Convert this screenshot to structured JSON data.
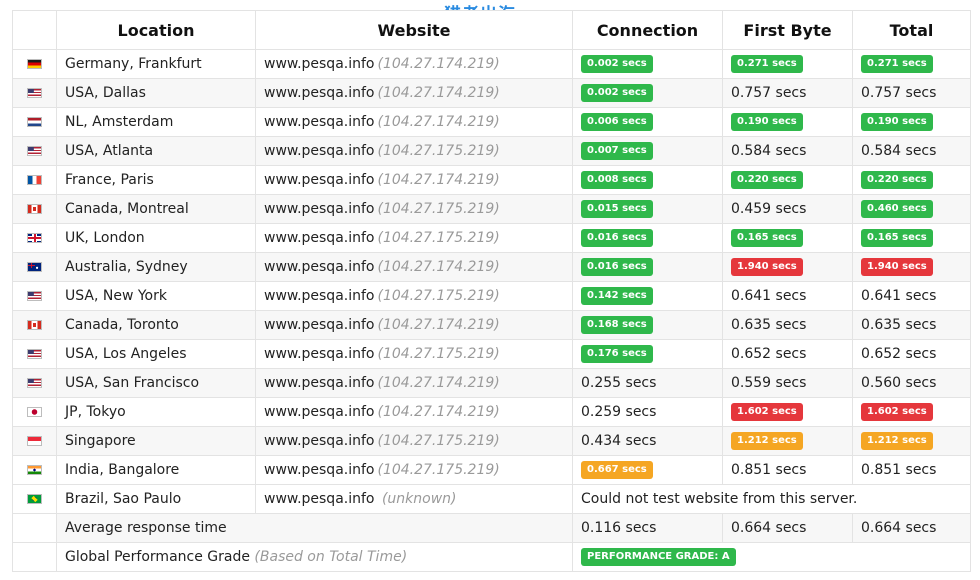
{
  "headers": {
    "location": "Location",
    "website": "Website",
    "connection": "Connection",
    "first_byte": "First Byte",
    "total": "Total"
  },
  "watermark": "猎者出海",
  "unit": "secs",
  "colors": {
    "green": "#2fb84b",
    "red": "#e5373c",
    "orange": "#f5a623"
  },
  "rows": [
    {
      "flag": "de",
      "flag_icon": "germany-flag-icon",
      "location": "Germany, Frankfurt",
      "host": "www.pesqa.info",
      "ip": "(104.27.174.219)",
      "connection": {
        "text": "0.002 secs",
        "badge": "green"
      },
      "first_byte": {
        "text": "0.271 secs",
        "badge": "green"
      },
      "total": {
        "text": "0.271 secs",
        "badge": "green"
      }
    },
    {
      "flag": "us",
      "flag_icon": "usa-flag-icon",
      "location": "USA, Dallas",
      "host": "www.pesqa.info",
      "ip": "(104.27.174.219)",
      "connection": {
        "text": "0.002 secs",
        "badge": "green"
      },
      "first_byte": {
        "text": "0.757 secs",
        "badge": ""
      },
      "total": {
        "text": "0.757 secs",
        "badge": ""
      }
    },
    {
      "flag": "nl",
      "flag_icon": "netherlands-flag-icon",
      "location": "NL, Amsterdam",
      "host": "www.pesqa.info",
      "ip": "(104.27.174.219)",
      "connection": {
        "text": "0.006 secs",
        "badge": "green"
      },
      "first_byte": {
        "text": "0.190 secs",
        "badge": "green"
      },
      "total": {
        "text": "0.190 secs",
        "badge": "green"
      }
    },
    {
      "flag": "us",
      "flag_icon": "usa-flag-icon",
      "location": "USA, Atlanta",
      "host": "www.pesqa.info",
      "ip": "(104.27.175.219)",
      "connection": {
        "text": "0.007 secs",
        "badge": "green"
      },
      "first_byte": {
        "text": "0.584 secs",
        "badge": ""
      },
      "total": {
        "text": "0.584 secs",
        "badge": ""
      }
    },
    {
      "flag": "fr",
      "flag_icon": "france-flag-icon",
      "location": "France, Paris",
      "host": "www.pesqa.info",
      "ip": "(104.27.174.219)",
      "connection": {
        "text": "0.008 secs",
        "badge": "green"
      },
      "first_byte": {
        "text": "0.220 secs",
        "badge": "green"
      },
      "total": {
        "text": "0.220 secs",
        "badge": "green"
      }
    },
    {
      "flag": "ca",
      "flag_icon": "canada-flag-icon",
      "location": "Canada, Montreal",
      "host": "www.pesqa.info",
      "ip": "(104.27.175.219)",
      "connection": {
        "text": "0.015 secs",
        "badge": "green"
      },
      "first_byte": {
        "text": "0.459 secs",
        "badge": ""
      },
      "total": {
        "text": "0.460 secs",
        "badge": "green"
      }
    },
    {
      "flag": "uk",
      "flag_icon": "uk-flag-icon",
      "location": "UK, London",
      "host": "www.pesqa.info",
      "ip": "(104.27.175.219)",
      "connection": {
        "text": "0.016 secs",
        "badge": "green"
      },
      "first_byte": {
        "text": "0.165 secs",
        "badge": "green"
      },
      "total": {
        "text": "0.165 secs",
        "badge": "green"
      }
    },
    {
      "flag": "au",
      "flag_icon": "australia-flag-icon",
      "location": "Australia, Sydney",
      "host": "www.pesqa.info",
      "ip": "(104.27.174.219)",
      "connection": {
        "text": "0.016 secs",
        "badge": "green"
      },
      "first_byte": {
        "text": "1.940 secs",
        "badge": "red"
      },
      "total": {
        "text": "1.940 secs",
        "badge": "red"
      }
    },
    {
      "flag": "us",
      "flag_icon": "usa-flag-icon",
      "location": "USA, New York",
      "host": "www.pesqa.info",
      "ip": "(104.27.175.219)",
      "connection": {
        "text": "0.142 secs",
        "badge": "green"
      },
      "first_byte": {
        "text": "0.641 secs",
        "badge": ""
      },
      "total": {
        "text": "0.641 secs",
        "badge": ""
      }
    },
    {
      "flag": "ca",
      "flag_icon": "canada-flag-icon",
      "location": "Canada, Toronto",
      "host": "www.pesqa.info",
      "ip": "(104.27.174.219)",
      "connection": {
        "text": "0.168 secs",
        "badge": "green"
      },
      "first_byte": {
        "text": "0.635 secs",
        "badge": ""
      },
      "total": {
        "text": "0.635 secs",
        "badge": ""
      }
    },
    {
      "flag": "us",
      "flag_icon": "usa-flag-icon",
      "location": "USA, Los Angeles",
      "host": "www.pesqa.info",
      "ip": "(104.27.175.219)",
      "connection": {
        "text": "0.176 secs",
        "badge": "green"
      },
      "first_byte": {
        "text": "0.652 secs",
        "badge": ""
      },
      "total": {
        "text": "0.652 secs",
        "badge": ""
      }
    },
    {
      "flag": "us",
      "flag_icon": "usa-flag-icon",
      "location": "USA, San Francisco",
      "host": "www.pesqa.info",
      "ip": "(104.27.174.219)",
      "connection": {
        "text": "0.255 secs",
        "badge": ""
      },
      "first_byte": {
        "text": "0.559 secs",
        "badge": ""
      },
      "total": {
        "text": "0.560 secs",
        "badge": ""
      }
    },
    {
      "flag": "jp",
      "flag_icon": "japan-flag-icon",
      "location": "JP, Tokyo",
      "host": "www.pesqa.info",
      "ip": "(104.27.174.219)",
      "connection": {
        "text": "0.259 secs",
        "badge": ""
      },
      "first_byte": {
        "text": "1.602 secs",
        "badge": "red"
      },
      "total": {
        "text": "1.602 secs",
        "badge": "red"
      }
    },
    {
      "flag": "sg",
      "flag_icon": "singapore-flag-icon",
      "location": "Singapore",
      "host": "www.pesqa.info",
      "ip": "(104.27.175.219)",
      "connection": {
        "text": "0.434 secs",
        "badge": ""
      },
      "first_byte": {
        "text": "1.212 secs",
        "badge": "orange"
      },
      "total": {
        "text": "1.212 secs",
        "badge": "orange"
      }
    },
    {
      "flag": "in",
      "flag_icon": "india-flag-icon",
      "location": "India, Bangalore",
      "host": "www.pesqa.info",
      "ip": "(104.27.175.219)",
      "connection": {
        "text": "0.667 secs",
        "badge": "orange"
      },
      "first_byte": {
        "text": "0.851 secs",
        "badge": ""
      },
      "total": {
        "text": "0.851 secs",
        "badge": ""
      }
    }
  ],
  "brazil_row": {
    "flag": "br",
    "flag_icon": "brazil-flag-icon",
    "location": "Brazil, Sao Paulo",
    "host": "www.pesqa.info",
    "ip": "(unknown)",
    "message": "Could not test website from this server."
  },
  "average": {
    "label": "Average response time",
    "connection": "0.116 secs",
    "first_byte": "0.664 secs",
    "total": "0.664 secs"
  },
  "grade": {
    "label": "Global Performance Grade",
    "note": "(Based on Total Time)",
    "badge_text": "PERFORMANCE GRADE:",
    "grade": "A"
  }
}
